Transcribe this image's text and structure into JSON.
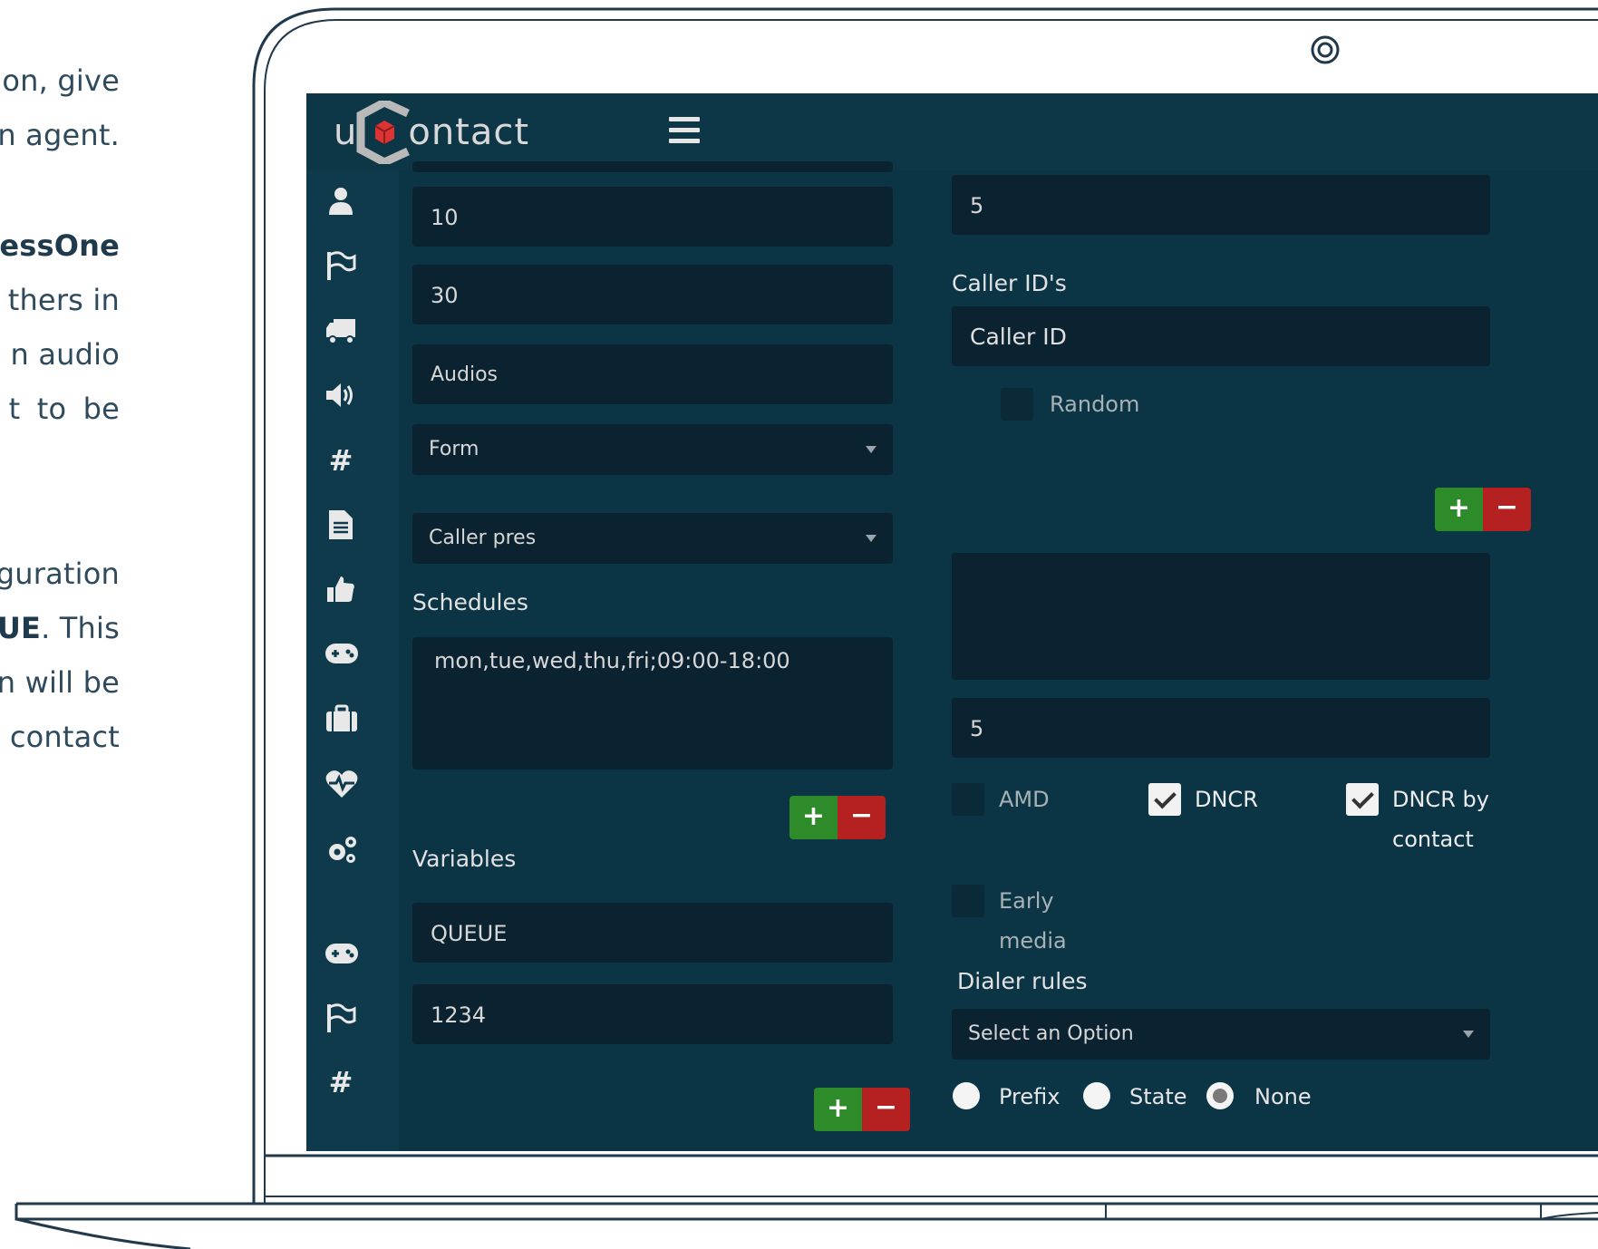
{
  "doc_text": {
    "l1": "on, give",
    "l2": "n agent.",
    "l3_bold": "essOne",
    "l4": "thers in",
    "l5": "n audio",
    "l6": "t  to  be",
    "l7": "guration",
    "l8_bold": "UE",
    "l8_rest": ". This",
    "l9": "n will be",
    "l10": "contact"
  },
  "app": {
    "logo_u": "u",
    "logo_rest": "ontact"
  },
  "sidebar_icons": [
    "user-icon",
    "flag-icon",
    "truck-icon",
    "volume-icon",
    "hashtag-icon",
    "file-icon",
    "thumbs-up-icon",
    "gamepad-icon",
    "suitcase-icon",
    "heartbeat-icon",
    "cogs-icon",
    "gamepad-icon",
    "flag-icon",
    "hashtag-icon"
  ],
  "left_col": {
    "field1": "10",
    "field2": "30",
    "audios": "Audios",
    "form_select": "Form",
    "caller_pres_select": "Caller pres",
    "schedules_label": "Schedules",
    "schedules_value": "mon,tue,wed,thu,fri;09:00-18:00",
    "variables_label": "Variables",
    "var_name": "QUEUE",
    "var_value": "1234"
  },
  "right_col": {
    "field_top": "5",
    "caller_ids_label": "Caller ID's",
    "caller_id_placeholder": "Caller ID",
    "random_label": "Random",
    "field_5": "5",
    "amd_label": "AMD",
    "dncr_label": "DNCR",
    "dncr_contact_l1": "DNCR by",
    "dncr_contact_l2": "contact",
    "early_media_l1": "Early",
    "early_media_l2": "media",
    "dialer_rules_label": "Dialer rules",
    "dialer_select": "Select an Option",
    "radio_prefix": "Prefix",
    "radio_state": "State",
    "radio_none": "None"
  },
  "buttons": {
    "plus": "+",
    "minus": "−"
  },
  "colors": {
    "primary_bg": "#0b3445",
    "field_bg": "#0b2230",
    "plus": "#2e8b2a",
    "minus": "#b52020"
  }
}
